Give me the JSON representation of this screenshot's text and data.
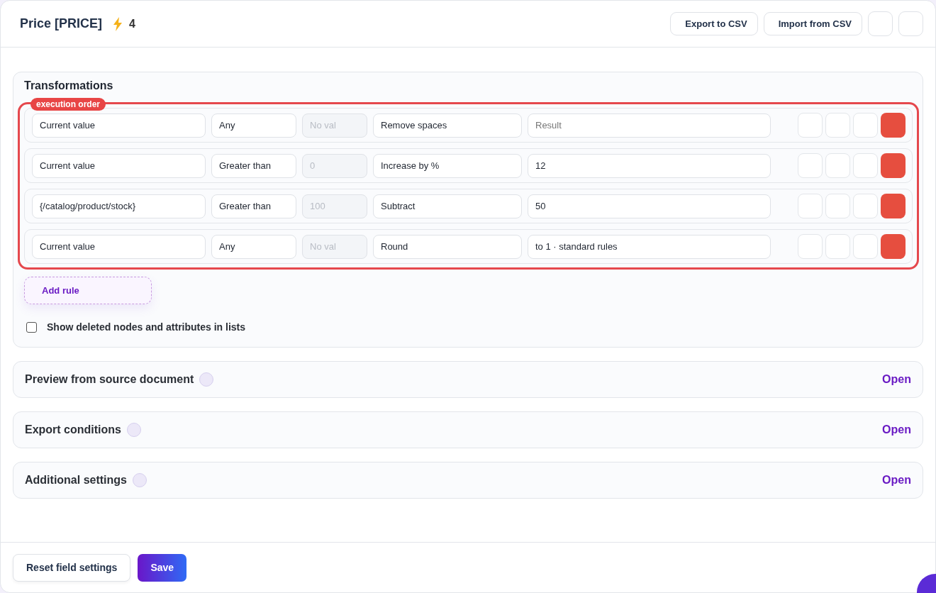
{
  "header": {
    "title": "Price [PRICE]",
    "bolt_count": "4",
    "buttons": [
      "Export to CSV",
      "Import from CSV"
    ]
  },
  "transformations": {
    "title": "Transformations",
    "badge": "execution order",
    "rules": [
      {
        "source": "Current value",
        "condition": "Any",
        "operand": {
          "placeholder": "No val",
          "disabled": true
        },
        "action": "Remove spaces",
        "result": {
          "placeholder": "Result"
        }
      },
      {
        "source": "Current value",
        "condition": "Greater than",
        "operand": {
          "placeholder": "0",
          "disabled": true
        },
        "action": "Increase by %",
        "result": {
          "value": "12"
        }
      },
      {
        "source": "{/catalog/product/stock}",
        "condition": "Greater than",
        "operand": {
          "placeholder": "100",
          "disabled": true
        },
        "action": "Subtract",
        "result": {
          "value": "50"
        }
      },
      {
        "source": "Current value",
        "condition": "Any",
        "operand": {
          "placeholder": "No val",
          "disabled": true
        },
        "action": "Round",
        "result": {
          "value": "to 1 · standard rules"
        }
      }
    ],
    "add_rule": "Add rule",
    "show_deleted": {
      "label": "Show deleted nodes and attributes in lists",
      "checked": false
    }
  },
  "sections": [
    {
      "title": "Preview from source document",
      "action": "Open"
    },
    {
      "title": "Export conditions",
      "action": "Open"
    },
    {
      "title": "Additional settings",
      "action": "Open"
    }
  ],
  "footer": {
    "reset": "Reset field settings",
    "save": "Save"
  }
}
